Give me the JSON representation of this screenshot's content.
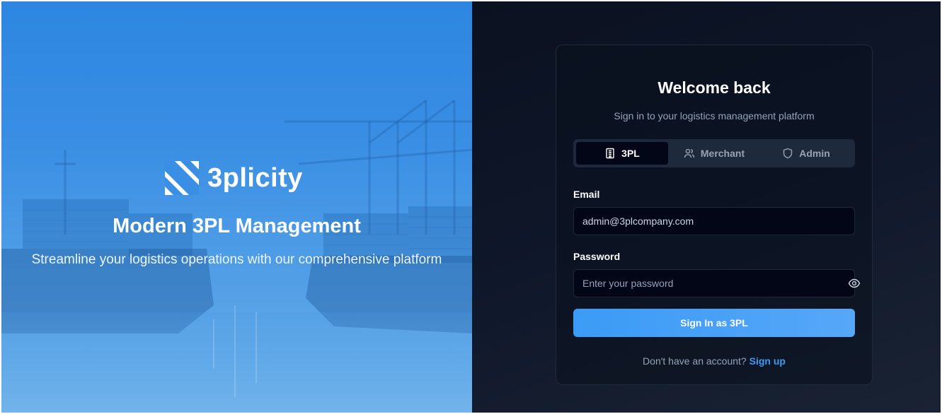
{
  "hero": {
    "brand_name": "3plicity",
    "title": "Modern 3PL Management",
    "subtitle": "Streamline your logistics operations with our comprehensive platform"
  },
  "login": {
    "title": "Welcome back",
    "subtitle": "Sign in to your logistics management platform",
    "tabs": [
      {
        "label": "3PL",
        "icon": "building-icon",
        "active": true
      },
      {
        "label": "Merchant",
        "icon": "users-icon",
        "active": false
      },
      {
        "label": "Admin",
        "icon": "shield-icon",
        "active": false
      }
    ],
    "email_label": "Email",
    "email_value": "admin@3plcompany.com",
    "password_label": "Password",
    "password_placeholder": "Enter your password",
    "submit_label": "Sign In as 3PL",
    "footer_text": "Don't have an account?",
    "signup_label": "Sign up"
  },
  "colors": {
    "accent": "#3b9bf6",
    "panel_bg": "#0f172a",
    "hero_blue": "#3a8fe4"
  }
}
